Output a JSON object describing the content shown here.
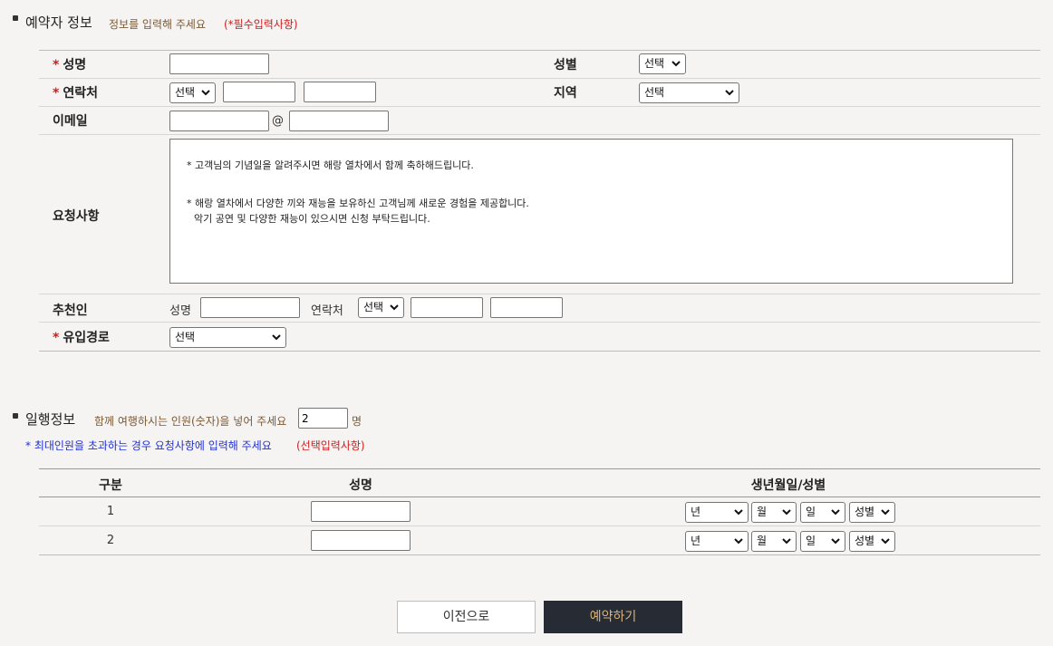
{
  "reserver": {
    "title": "예약자 정보",
    "desc": "정보를 입력해 주세요",
    "required_note": "(*필수입력사항)",
    "required_mark": "*",
    "name_label": "성명",
    "gender_label": "성별",
    "gender_select": "선택",
    "contact_label": "연락처",
    "contact_select": "선택",
    "region_label": "지역",
    "region_select": "선택",
    "email_label": "이메일",
    "email_at": "@",
    "request_label": "요청사항",
    "request_text_1": "* 고객님의 기념일을 알려주시면 해랑 열차에서 함께 축하해드립니다.",
    "request_text_2": "* 해랑 열차에서 다양한 끼와 재능을 보유하신 고객님께 새로운 경험을 제공합니다.",
    "request_text_3": "악기 공연 및 다양한 재능이 있으시면 신청 부탁드립니다.",
    "recommender_label": "추천인",
    "recommender_name_label": "성명",
    "recommender_contact_label": "연락처",
    "recommender_contact_select": "선택",
    "source_label": "유입경로",
    "source_select": "선택"
  },
  "companions": {
    "title": "일행정보",
    "desc": "함께 여행하시는 인원(숫자)을 넣어 주세요",
    "count_value": "2",
    "count_unit": "명",
    "note": "* 최대인원을 초과하는 경우 요청사항에 입력해 주세요",
    "optional_note": "(선택입력사항)",
    "headers": [
      "구분",
      "성명",
      "생년월일/성별"
    ],
    "rows": [
      {
        "no": "1",
        "year": "년",
        "month": "월",
        "day": "일",
        "gender": "성별"
      },
      {
        "no": "2",
        "year": "년",
        "month": "월",
        "day": "일",
        "gender": "성별"
      }
    ]
  },
  "buttons": {
    "prev": "이전으로",
    "reserve": "예약하기"
  },
  "colors": {
    "background": "#f6f3f3",
    "required_red": "#cc1f1f",
    "desc_brown": "#7a5a34",
    "note_blue": "#2233cc",
    "reserve_button_bg": "#272b33",
    "reserve_button_text": "#d9b27a"
  }
}
